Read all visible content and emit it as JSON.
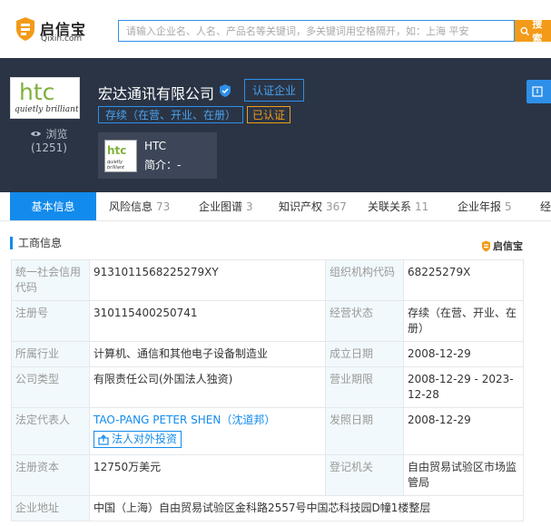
{
  "header": {
    "brand": "启信宝",
    "domain": "Qixin.com",
    "search_placeholder": "请输入企业名、人名、产品名等关键词，多关键词用空格隔开，如：上海 平安",
    "search_button": "搜索"
  },
  "company": {
    "logo_text": "htc",
    "logo_tagline": "quietly brilliant",
    "name": "宏达通讯有限公司",
    "cert_button": "认证企业",
    "status": "存续（在营、开业、在册）",
    "certified": "已认证",
    "views_label": "浏览",
    "views_count": "(1251)",
    "brand_card": {
      "thumb_text": "htc",
      "thumb_tag": "quietly brilliant",
      "name": "HTC",
      "desc": "简介：-"
    }
  },
  "tabs": [
    {
      "label": "基本信息",
      "count": ""
    },
    {
      "label": "风险信息",
      "count": "73"
    },
    {
      "label": "企业图谱",
      "count": "3"
    },
    {
      "label": "知识产权",
      "count": "367"
    },
    {
      "label": "关联关系",
      "count": "11"
    },
    {
      "label": "企业年报",
      "count": "5"
    },
    {
      "label": "经",
      "count": ""
    }
  ],
  "section": {
    "title": "工商信息",
    "watermark": "启信宝"
  },
  "info": {
    "r1": {
      "k1": "统一社会信用代码",
      "v1": "9131011568225279XY",
      "k2": "组织机构代码",
      "v2": "68225279X"
    },
    "r2": {
      "k1": "注册号",
      "v1": "310115400250741",
      "k2": "经营状态",
      "v2": "存续（在营、开业、在册）"
    },
    "r3": {
      "k1": "所属行业",
      "v1": "计算机、通信和其他电子设备制造业",
      "k2": "成立日期",
      "v2": "2008-12-29"
    },
    "r4": {
      "k1": "公司类型",
      "v1": "有限责任公司(外国法人独资)",
      "k2": "营业期限",
      "v2": "2008-12-29 - 2023-12-28"
    },
    "r5": {
      "k1": "法定代表人",
      "v1": "TAO-PANG PETER SHEN（沈道邦）",
      "btn": "法人对外投资",
      "k2": "发照日期",
      "v2": "2008-12-29"
    },
    "r6": {
      "k1": "注册资本",
      "v1": "12750万美元",
      "k2": "登记机关",
      "v2": "自由贸易试验区市场监管局"
    },
    "r7": {
      "k1": "企业地址",
      "v1": "中国（上海）自由贸易试验区金科路2557号中国芯科技园D幢1楼整层"
    }
  }
}
